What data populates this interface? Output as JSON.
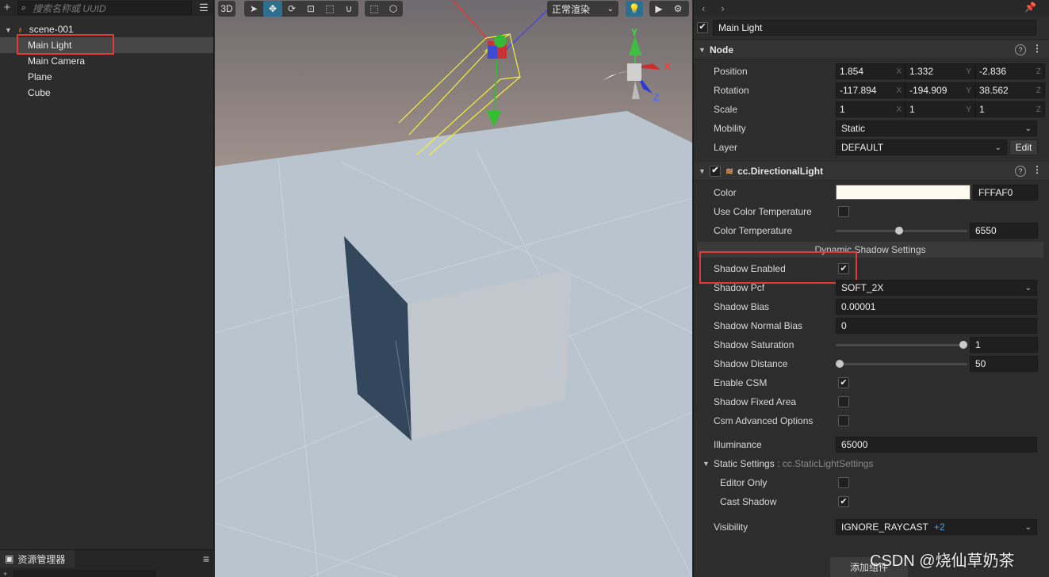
{
  "hierarchy": {
    "search_placeholder": "搜索名称或 UUID",
    "scene_name": "scene-001",
    "nodes": [
      "Main Light",
      "Main Camera",
      "Plane",
      "Cube"
    ],
    "selected": "Main Light"
  },
  "assets": {
    "tab_label": "资源管理器"
  },
  "scene_toolbar": {
    "mode_label": "3D",
    "render_mode": "正常渲染",
    "gizmo_axes": [
      "Y",
      "X",
      "Z"
    ]
  },
  "inspector": {
    "node_name": "Main Light",
    "node_section": {
      "title": "Node",
      "position_label": "Position",
      "position": [
        "1.854",
        "1.332",
        "-2.836"
      ],
      "rotation_label": "Rotation",
      "rotation": [
        "-117.894",
        "-194.909",
        "38.562"
      ],
      "scale_label": "Scale",
      "scale": [
        "1",
        "1",
        "1"
      ],
      "axis_letters": [
        "X",
        "Y",
        "Z"
      ],
      "mobility_label": "Mobility",
      "mobility": "Static",
      "layer_label": "Layer",
      "layer": "DEFAULT",
      "edit_label": "Edit"
    },
    "light_section": {
      "title": "cc.DirectionalLight",
      "color_label": "Color",
      "color_hex": "FFFAF0",
      "color_swatch": "#FFFAF0",
      "use_color_temp_label": "Use Color Temperature",
      "use_color_temp": false,
      "color_temp_label": "Color Temperature",
      "color_temp": "6550",
      "color_temp_fraction": 0.48,
      "shadow_settings_title": "Dynamic Shadow Settings",
      "shadow_enabled_label": "Shadow Enabled",
      "shadow_enabled": true,
      "shadow_pcf_label": "Shadow Pcf",
      "shadow_pcf": "SOFT_2X",
      "shadow_bias_label": "Shadow Bias",
      "shadow_bias": "0.00001",
      "shadow_normal_bias_label": "Shadow Normal Bias",
      "shadow_normal_bias": "0",
      "shadow_saturation_label": "Shadow Saturation",
      "shadow_saturation": "1",
      "shadow_saturation_fraction": 1.0,
      "shadow_distance_label": "Shadow Distance",
      "shadow_distance": "50",
      "shadow_distance_fraction": 0.0,
      "enable_csm_label": "Enable CSM",
      "enable_csm": true,
      "shadow_fixed_area_label": "Shadow Fixed Area",
      "shadow_fixed_area": false,
      "csm_advanced_label": "Csm Advanced Options",
      "csm_advanced": false,
      "illuminance_label": "Illuminance",
      "illuminance": "65000",
      "static_settings_label": "Static Settings",
      "static_settings_type": ": cc.StaticLightSettings",
      "editor_only_label": "Editor Only",
      "editor_only": false,
      "cast_shadow_label": "Cast Shadow",
      "cast_shadow": true,
      "visibility_label": "Visibility",
      "visibility": "IGNORE_RAYCAST",
      "visibility_extra": "+2"
    },
    "add_component_label": "添加组件"
  },
  "watermark": "CSDN @烧仙草奶茶",
  "colors": {
    "highlight_box": "#e53935",
    "accent": "#2e6e8f",
    "link_blue": "#4aa3df"
  }
}
